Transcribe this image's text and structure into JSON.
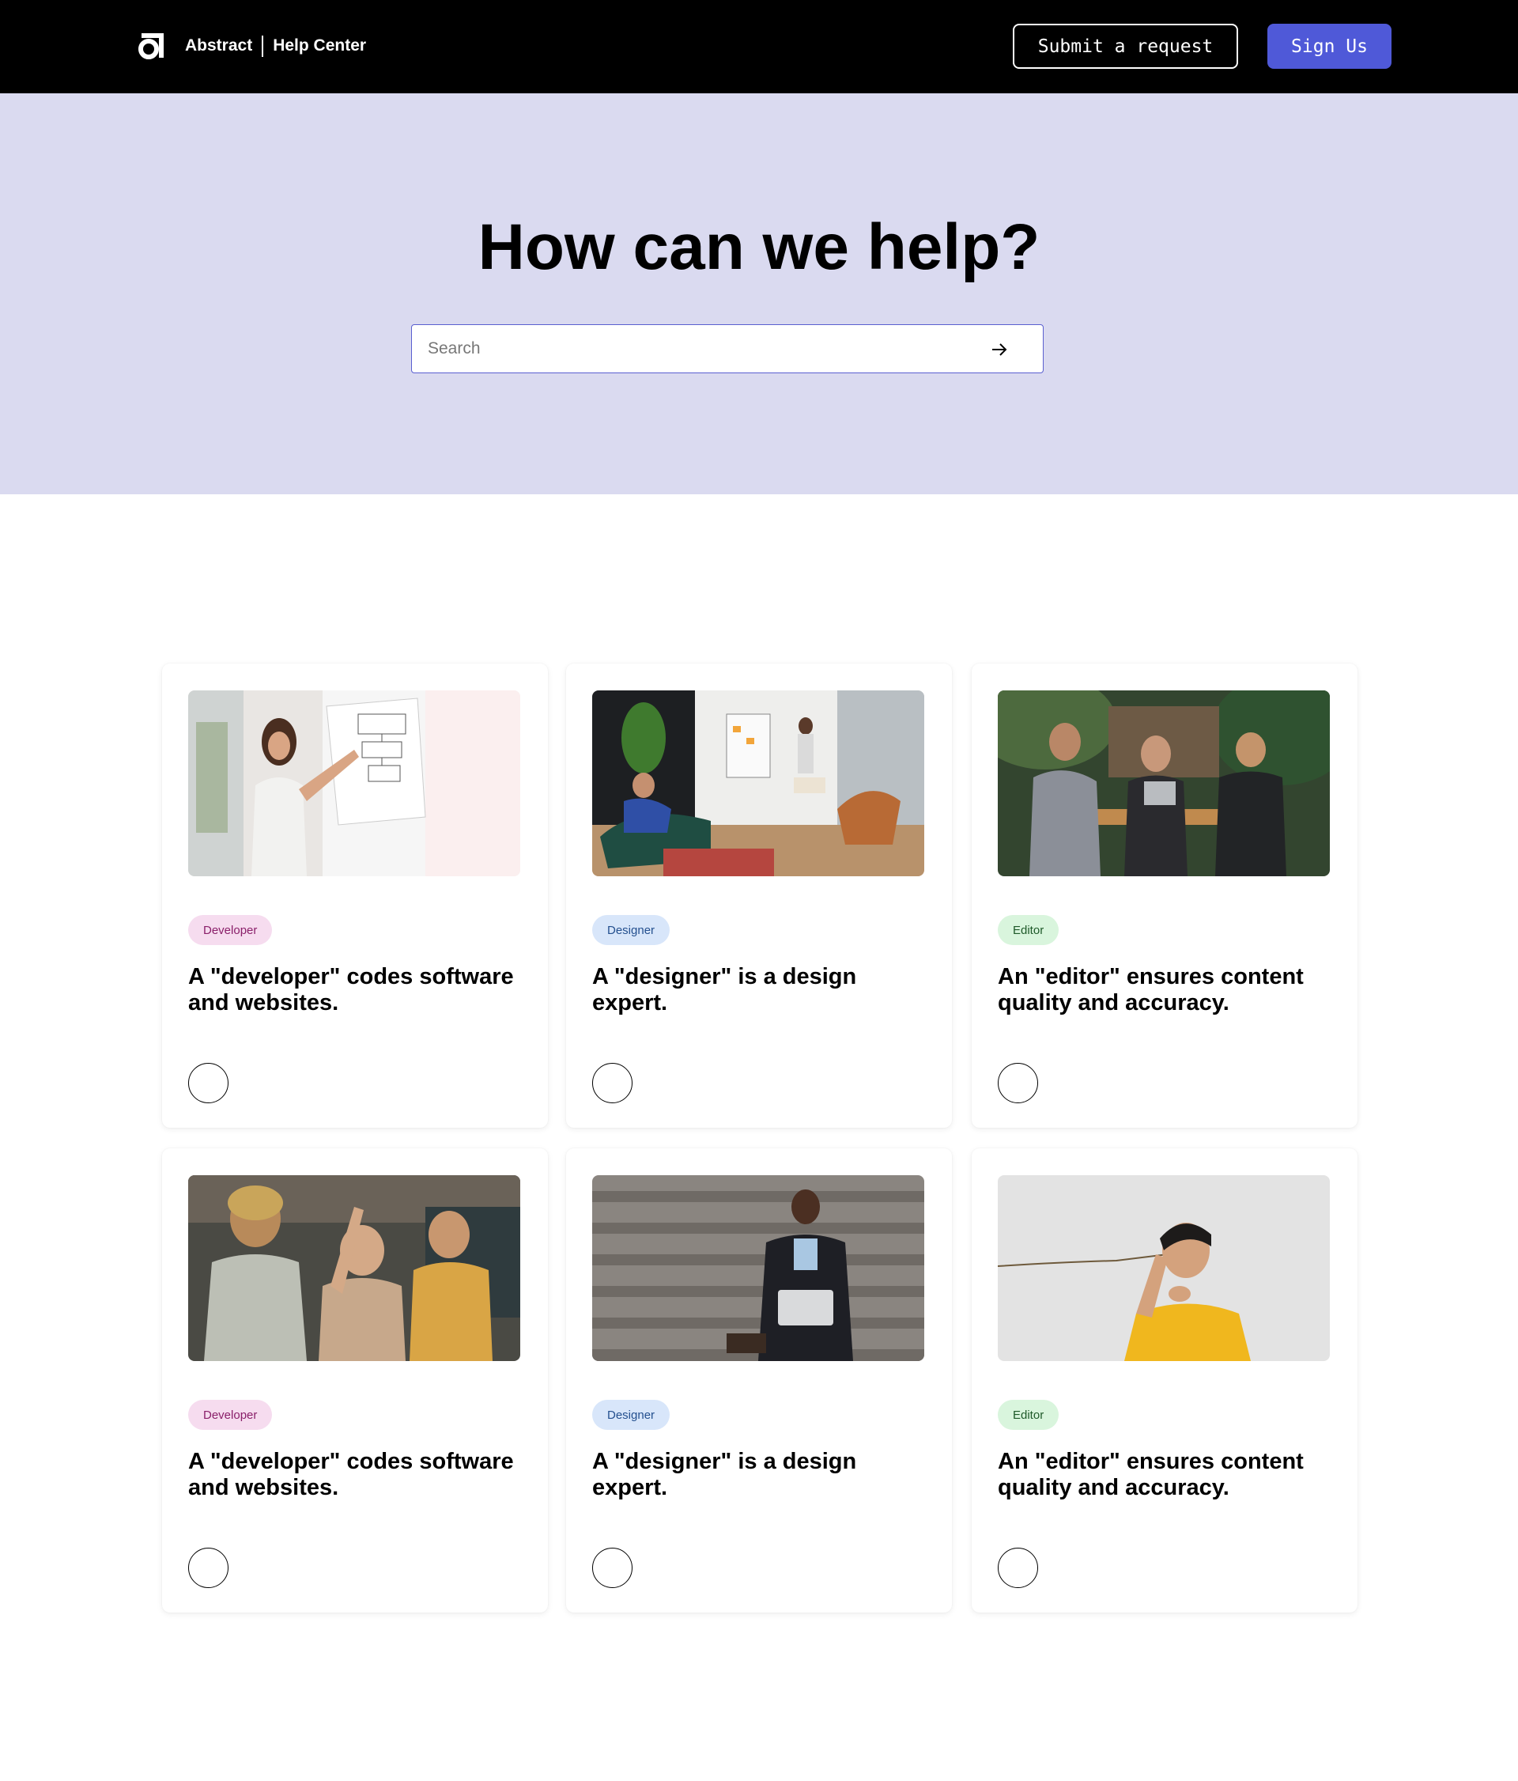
{
  "header": {
    "brand_name": "Abstract",
    "section_name": "Help Center",
    "submit_label": "Submit a request",
    "sign_label": "Sign Us",
    "logo_icon": "abstract-logo-icon"
  },
  "hero": {
    "title": "How can we help?",
    "search_placeholder": "Search",
    "search_icon": "arrow-right-icon"
  },
  "colors": {
    "header_bg": "#000000",
    "hero_bg": "#dadaf0",
    "accent": "#4f59d8",
    "tag_developer_bg": "#f6dcef",
    "tag_designer_bg": "#d8e6fa",
    "tag_editor_bg": "#d9f5dd"
  },
  "cards": [
    {
      "tag": "Developer",
      "title": "A \"developer\" codes software and websites.",
      "image": "woman-presenting-at-whiteboard-photo"
    },
    {
      "tag": "Designer",
      "title": "A \"designer\" is a design expert.",
      "image": "office-team-meeting-photo"
    },
    {
      "tag": "Editor",
      "title": "An \"editor\" ensures content quality and accuracy.",
      "image": "three-people-at-cafe-table-photo"
    },
    {
      "tag": "Developer",
      "title": "A \"developer\" codes software and websites.",
      "image": "three-people-writing-on-glass-photo"
    },
    {
      "tag": "Designer",
      "title": "A \"designer\" is a design expert.",
      "image": "man-with-laptop-on-stairs-photo"
    },
    {
      "tag": "Editor",
      "title": "An \"editor\" ensures content quality and accuracy.",
      "image": "person-holding-string-phone-photo"
    }
  ]
}
